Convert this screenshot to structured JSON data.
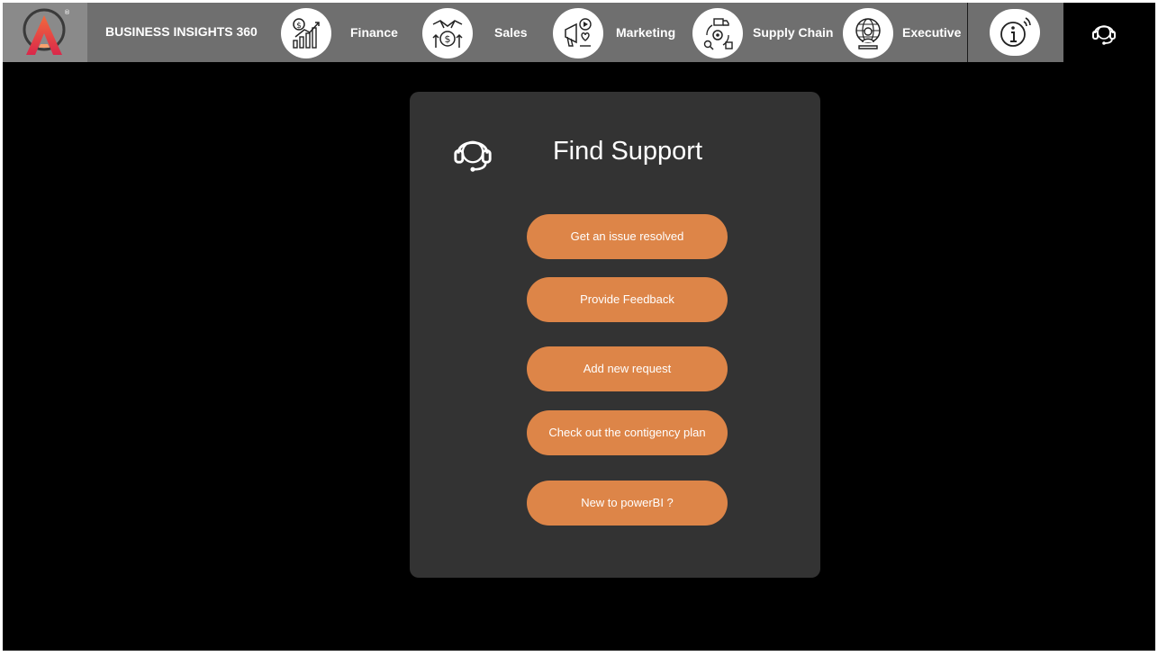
{
  "header": {
    "brand": "BUSINESS INSIGHTS 360",
    "logo_mark": "®",
    "nav_items": [
      {
        "label": "Finance",
        "icon": "finance-chart-icon"
      },
      {
        "label": "Sales",
        "icon": "handshake-money-icon"
      },
      {
        "label": "Marketing",
        "icon": "marketing-megaphone-icon"
      },
      {
        "label": "Supply Chain",
        "icon": "supply-chain-icon"
      },
      {
        "label": "Executive",
        "icon": "executive-globe-icon"
      }
    ],
    "info_icon": "info-icon",
    "support_icon": "headset-icon"
  },
  "panel": {
    "title": "Find Support",
    "buttons": [
      "Get an issue resolved",
      "Provide Feedback",
      "Add new request",
      "Check out the contigency plan",
      "New to powerBI ?"
    ]
  },
  "colors": {
    "nav_bg": "#6f6f6f",
    "logo_bg": "#8a8a8a",
    "panel_bg": "#333333",
    "button_accent": "#dd8548",
    "page_bg": "#000000"
  }
}
